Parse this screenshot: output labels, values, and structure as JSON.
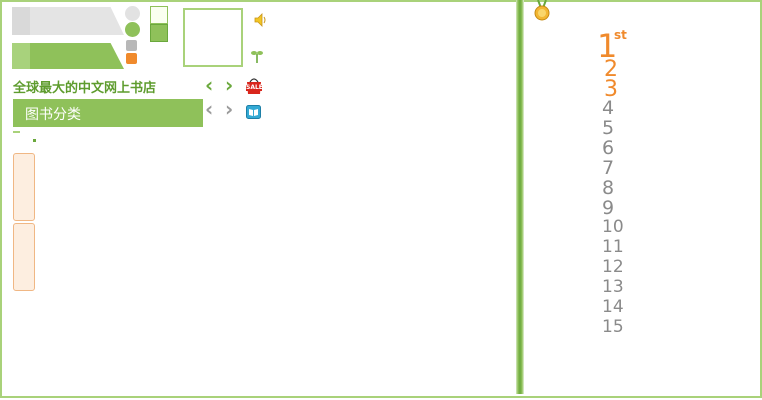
{
  "header": {
    "site_slogan": "全球最大的中文网上书店",
    "category_label": "图书分类"
  },
  "icons": {
    "speaker": "speaker-icon",
    "sprout": "sprout-icon",
    "sale_basket": "sale-basket-icon",
    "sale_text": "SALE",
    "book": "book-icon",
    "medal": "medal-icon"
  },
  "ranking": {
    "first_suffix": "st",
    "numbers": [
      "1",
      "2",
      "3",
      "4",
      "5",
      "6",
      "7",
      "8",
      "9",
      "10",
      "11",
      "12",
      "13",
      "14",
      "15"
    ]
  },
  "colors": {
    "brand_green": "#8fc15a",
    "dark_green": "#5e9c2e",
    "orange": "#f08a2c",
    "gray_text": "#8a8a8a"
  }
}
